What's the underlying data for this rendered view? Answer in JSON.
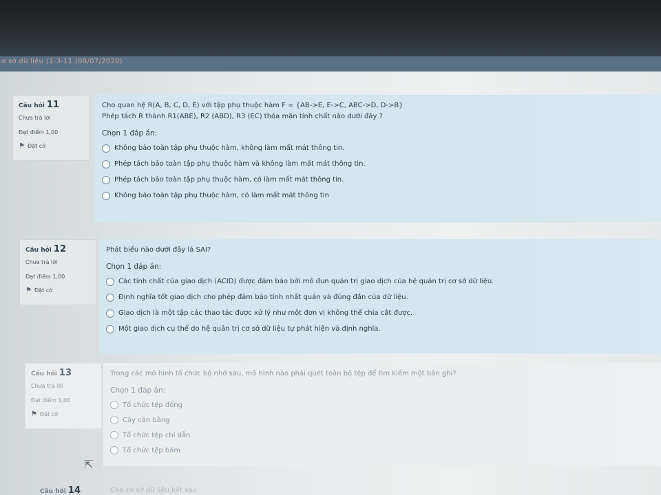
{
  "window": {
    "tab_title": "ơ sở dữ liệu (1-3-11 (08/07/2020)"
  },
  "questions": [
    {
      "label": "Câu hỏi",
      "number": "11",
      "state": "Chưa trả lời",
      "grade": "Đạt điểm 1,00",
      "flag": "Đặt cờ",
      "text_lines": [
        "Cho quan hệ R(A, B, C, D, E) với tập phụ thuộc hàm F = {AB->E, E->C, ABC->D, D->B}",
        "Phép tách R thành R1(ABE), R2 (ABD), R3 (EC) thỏa mãn tính chất nào dưới đây ?"
      ],
      "prompt": "Chọn 1 đáp án:",
      "answers": [
        "Không bảo toàn tập phụ thuộc hàm, không làm mất mát thông tin.",
        "Phép tách bảo toàn tập phụ thuộc hàm và không làm mất mát thông tin.",
        "Phép tách bảo toàn tập phụ thuộc hàm, có làm mất mát thông tin.",
        "Không bảo toàn tập phụ thuộc hàm, có làm mất mát thông tin"
      ]
    },
    {
      "label": "Câu hỏi",
      "number": "12",
      "state": "Chưa trả lời",
      "grade": "Đạt điểm 1,00",
      "flag": "Đặt cờ",
      "text_lines": [
        "Phát biểu nào dưới đây là SAI?"
      ],
      "prompt": "Chọn 1 đáp án:",
      "answers": [
        "Các tính chất của giao dịch (ACID) được đảm bảo bởi mô đun quản trị giao dịch của hệ quản trị cơ sở dữ liệu.",
        "Định nghĩa tốt giao dịch cho phép đảm bảo tính nhất quán và đúng đắn của dữ liệu.",
        "Giao dịch là một tập các thao tác được xử lý như một đơn vị không thể chia cắt được.",
        "Một giao dịch cụ thể do hệ quản trị cơ sở dữ liệu tự phát hiện và định nghĩa."
      ]
    },
    {
      "label": "Câu hỏi",
      "number": "13",
      "state": "Chưa trả lời",
      "grade": "Đạt điểm 1,00",
      "flag": "Đặt cờ",
      "text_lines": [
        "Trong các mô hình tổ chức bộ nhớ sau, mô hình nào phải quét toàn bộ tệp để tìm kiếm một bản ghi?"
      ],
      "prompt": "Chọn 1 đáp án:",
      "answers": [
        "Tổ chức tệp đống",
        "Cây cân bằng",
        "Tổ chức tệp chỉ dẫn",
        "Tổ chức tệp băm"
      ]
    },
    {
      "label": "Câu hỏi",
      "number": "14",
      "text_lines": [
        "Cho cơ sở dữ liệu kết sau"
      ]
    }
  ],
  "icons": {
    "flag": "flag-icon",
    "cursor": "mouse-cursor-icon"
  }
}
